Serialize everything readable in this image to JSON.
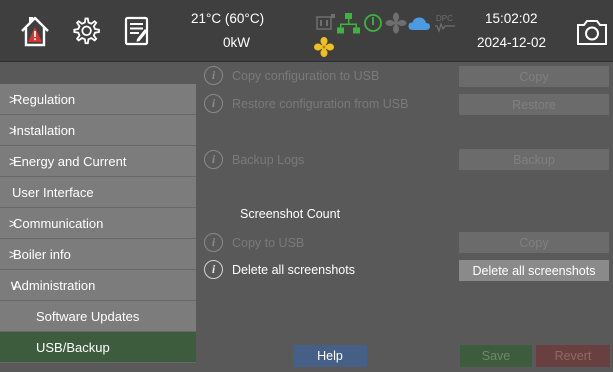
{
  "header": {
    "temperature": "21°C (60°C)",
    "power": "0kW",
    "time": "15:02:02",
    "date": "2024-12-02"
  },
  "sidebar": {
    "items": [
      {
        "label": "Regulation",
        "chevron": ">"
      },
      {
        "label": "Installation",
        "chevron": ">"
      },
      {
        "label": "Energy and Current",
        "chevron": ">"
      },
      {
        "label": "User Interface",
        "chevron": ""
      },
      {
        "label": "Communication",
        "chevron": ">"
      },
      {
        "label": "Boiler info",
        "chevron": ">"
      },
      {
        "label": "Administration",
        "chevron": "∨"
      },
      {
        "label": "Software Updates",
        "chevron": ""
      },
      {
        "label": "USB/Backup",
        "chevron": ""
      }
    ]
  },
  "main": {
    "rows": [
      {
        "label": "Copy configuration to USB",
        "button": "Copy"
      },
      {
        "label": "Restore configuration from USB",
        "button": "Restore"
      },
      {
        "label": "Backup Logs",
        "button": "Backup"
      },
      {
        "label": "Copy to USB",
        "button": "Copy"
      },
      {
        "label": "Delete all screenshots",
        "button": "Delete all screenshots"
      }
    ],
    "screenshot_section_title": "Screenshot Count",
    "info_glyph": "i"
  },
  "footer": {
    "help": "Help",
    "save": "Save",
    "revert": "Revert"
  },
  "status_icons": [
    "plug-icon",
    "network-icon",
    "power-icon",
    "fan-icon",
    "cloud-icon",
    "dpc-icon"
  ],
  "status_icon_text": {
    "dpc": "DPC"
  },
  "colors": {
    "header_bg": "#3f3f3f",
    "sidebar_item_bg": "#7c7c7c",
    "active_item_bg": "#3d5b3d",
    "help_bg": "#465f87",
    "revert_bg": "#6a3f3f",
    "alert_red": "#d9352e",
    "network_green": "#3db53d",
    "cloud_blue": "#4a9be0",
    "fan_yellow": "#f0c020"
  }
}
